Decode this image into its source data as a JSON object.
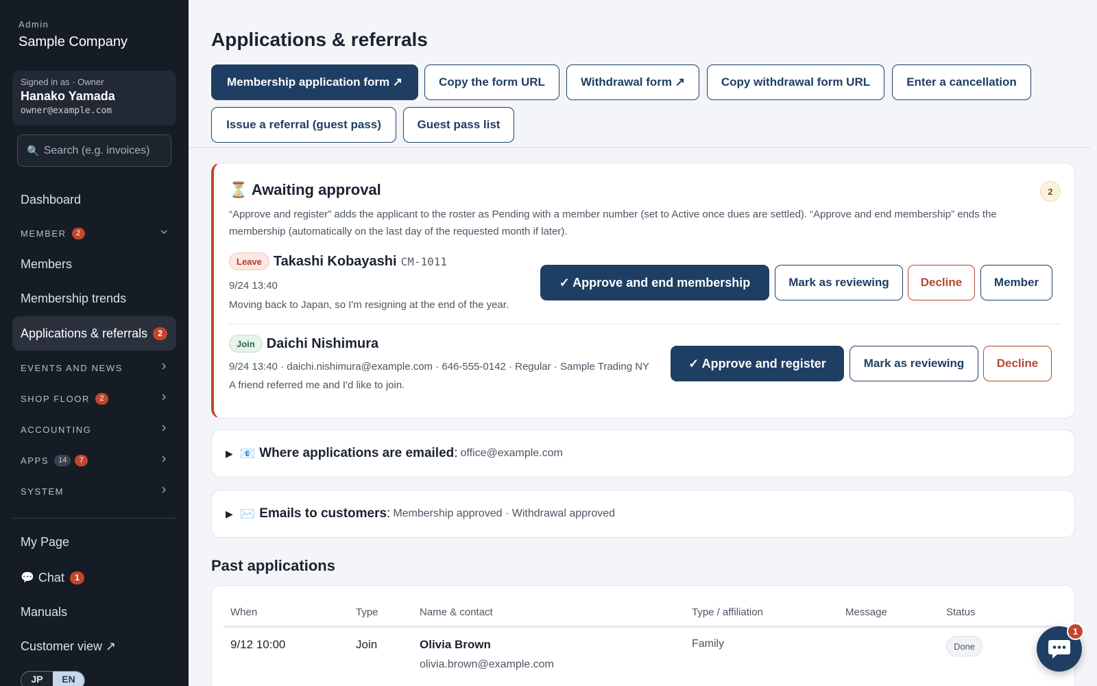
{
  "sidebar": {
    "brand_small": "Admin",
    "brand_name": "Sample Company",
    "signin": {
      "label": "Signed in as · Owner",
      "name": "Hanako Yamada",
      "email": "owner@example.com"
    },
    "search": {
      "placeholder": "Search (e.g. invoices)",
      "icon": "magnifier-icon"
    },
    "dashboard": "Dashboard",
    "member_section": {
      "label": "MEMBER",
      "badge": "2"
    },
    "members": "Members",
    "membership_trends": "Membership trends",
    "applications": {
      "label": "Applications & referrals",
      "badge": "2"
    },
    "events_section": {
      "label": "EVENTS AND NEWS"
    },
    "shop_section": {
      "label": "SHOP FLOOR",
      "badge": "2"
    },
    "accounting_section": {
      "label": "ACCOUNTING"
    },
    "apps_section": {
      "label": "APPS",
      "count": "14",
      "badge": "7"
    },
    "system_section": {
      "label": "SYSTEM"
    },
    "my_page": "My Page",
    "chat": {
      "label": "Chat",
      "badge": "1"
    },
    "manuals": "Manuals",
    "customer_view": "Customer view ↗",
    "lang": {
      "jp": "JP",
      "en": "EN",
      "active": "EN"
    }
  },
  "main": {
    "title": "Applications & referrals",
    "actions": [
      "Membership application form ↗",
      "Copy the form URL",
      "Withdrawal form ↗",
      "Copy withdrawal form URL",
      "Enter a cancellation",
      "Issue a referral (guest pass)",
      "Guest pass list"
    ],
    "approval": {
      "icon": "hourglass-icon",
      "title": "Awaiting approval",
      "count": "2",
      "description": "“Approve and register” adds the applicant to the roster as Pending with a member number (set to Active once dues are settled). “Approve and end membership” ends the membership (automatically on the last day of the requested month if later).",
      "items": [
        {
          "tag": "Leave",
          "name": "Takashi Kobayashi",
          "code": "CM-1011",
          "meta": "9/24 13:40",
          "message": "Moving back to Japan, so I'm resigning at the end of the year.",
          "primary": "✓ Approve and end membership",
          "review": "Mark as reviewing",
          "decline": "Decline",
          "member": "Member"
        },
        {
          "tag": "Join",
          "name": "Daichi Nishimura",
          "meta": "9/24 13:40 · daichi.nishimura@example.com · 646-555-0142 · Regular · Sample Trading NY",
          "message": "A friend referred me and I'd like to join.",
          "primary": "✓ Approve and register",
          "review": "Mark as reviewing",
          "decline": "Decline"
        }
      ]
    },
    "emailed": {
      "label": "Where applications are emailed",
      "value": "office@example.com",
      "icon": "inbox-icon"
    },
    "customer_emails": {
      "label": "Emails to customers",
      "value": "Membership approved · Withdrawal approved",
      "icon": "envelope-icon"
    },
    "past": {
      "title": "Past applications",
      "columns": [
        "When",
        "Type",
        "Name & contact",
        "Type / affiliation",
        "Message",
        "Status"
      ],
      "rows": [
        {
          "when": "9/12 10:00",
          "type": "Join",
          "name": "Olivia Brown",
          "email": "olivia.brown@example.com",
          "affiliation": "Family",
          "message": "",
          "status": "Done"
        }
      ]
    }
  },
  "chat_fab": {
    "badge": "1",
    "icon": "chat-bubble-icon"
  },
  "colors": {
    "sidebar_bg": "#161c25",
    "primary": "#1f3e63",
    "danger": "#b5472f",
    "badge": "#c2462d"
  }
}
